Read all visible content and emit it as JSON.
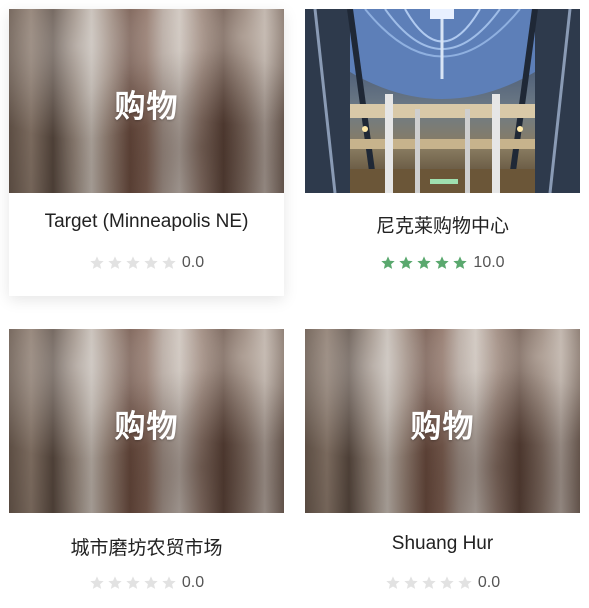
{
  "colors": {
    "star_empty": "#e2e2e2",
    "star_filled": "#5aa86e",
    "title_text": "#222222",
    "score_text": "#555555"
  },
  "cards": [
    {
      "image_label": "购物",
      "title": "Target (Minneapolis NE)",
      "rating": 0,
      "score": "0.0"
    },
    {
      "image_label": "",
      "title": "尼克莱购物中心",
      "rating": 5,
      "score": "10.0"
    },
    {
      "image_label": "购物",
      "title": "城市磨坊农贸市场",
      "rating": 0,
      "score": "0.0"
    },
    {
      "image_label": "购物",
      "title": "Shuang Hur",
      "rating": 0,
      "score": "0.0"
    }
  ]
}
